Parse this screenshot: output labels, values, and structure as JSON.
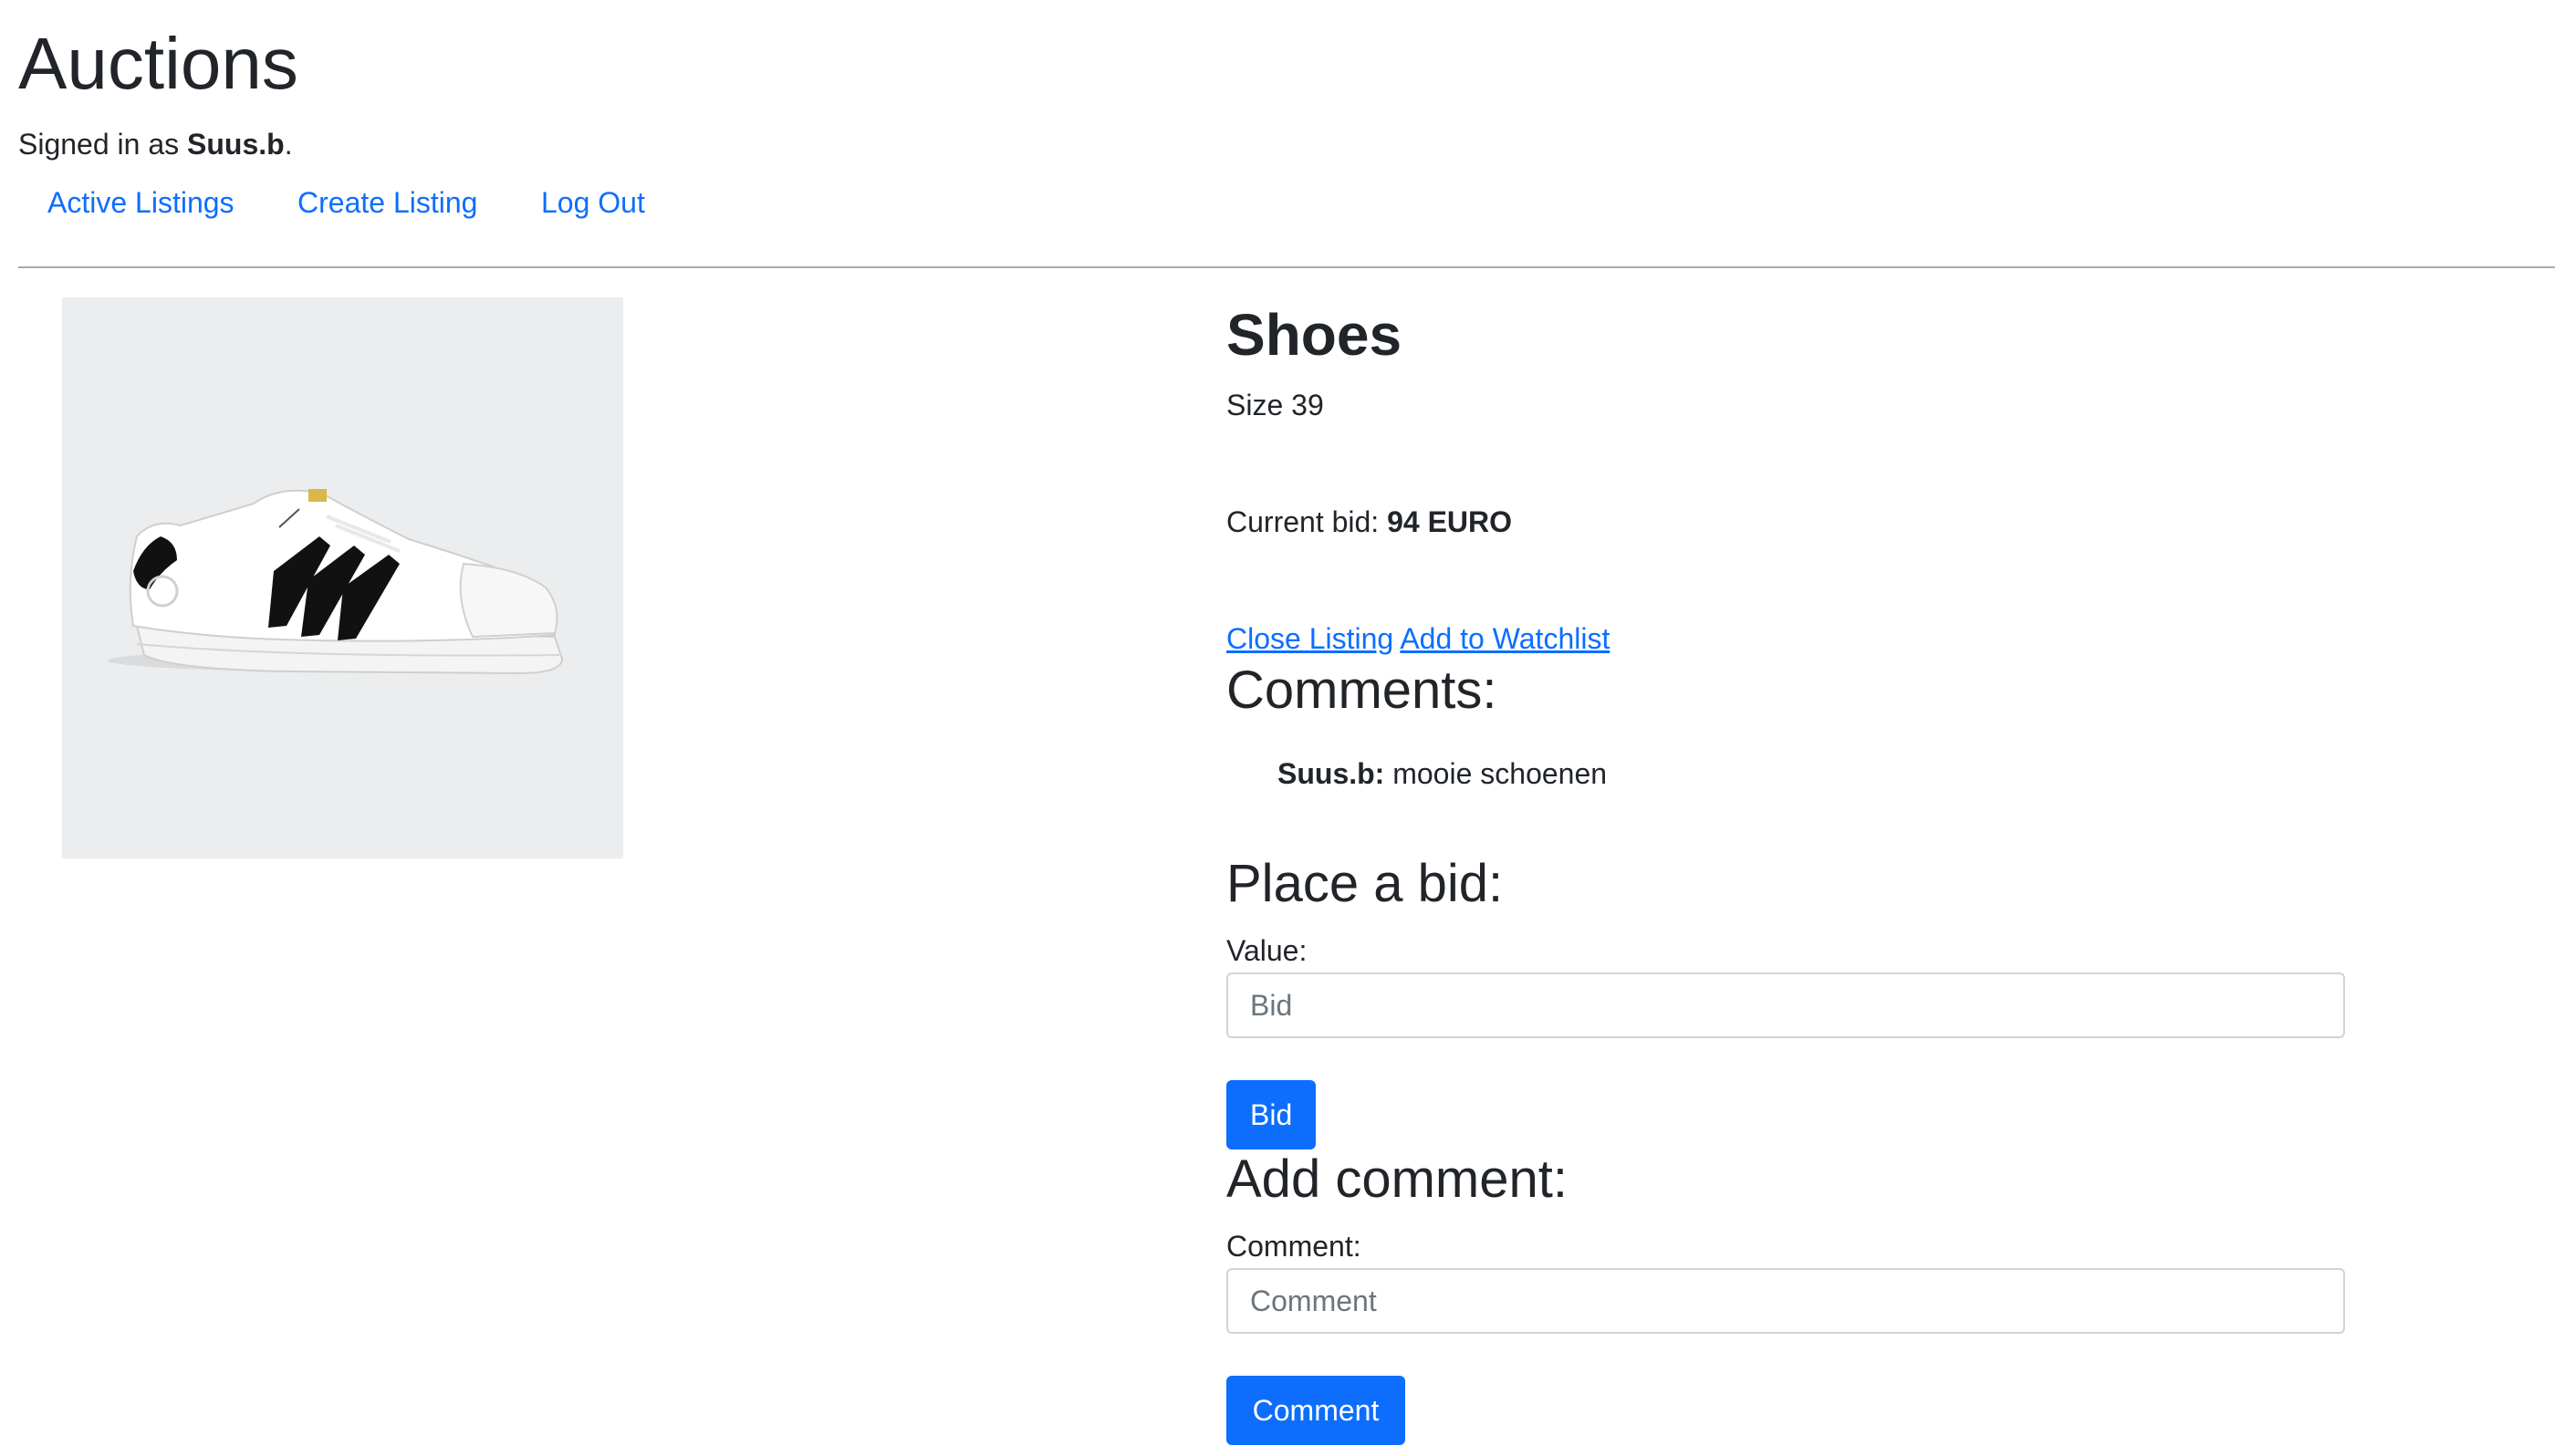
{
  "header": {
    "site_title": "Auctions",
    "signed_in_prefix": "Signed in as ",
    "username": "Suus.b",
    "signed_in_suffix": ".",
    "nav": [
      {
        "label": "Active Listings"
      },
      {
        "label": "Create Listing"
      },
      {
        "label": "Log Out"
      }
    ]
  },
  "listing": {
    "title": "Shoes",
    "description": "Size 39",
    "current_bid_label": "Current bid: ",
    "current_bid_value": "94 EURO",
    "close_listing_label": "Close Listing",
    "watchlist_label": "Add to Watchlist",
    "image_icon": "sneaker-image"
  },
  "comments": {
    "heading": "Comments:",
    "items": [
      {
        "author": "Suus.b:",
        "text": "mooie schoenen"
      }
    ]
  },
  "bid_form": {
    "heading": "Place a bid:",
    "label": "Value:",
    "placeholder": "Bid",
    "button_label": "Bid"
  },
  "comment_form": {
    "heading": "Add comment:",
    "label": "Comment:",
    "placeholder": "Comment",
    "button_label": "Comment"
  },
  "colors": {
    "link": "#0d6efd",
    "button_bg": "#0d6efd",
    "text": "#212529",
    "image_bg": "#ebedee"
  }
}
